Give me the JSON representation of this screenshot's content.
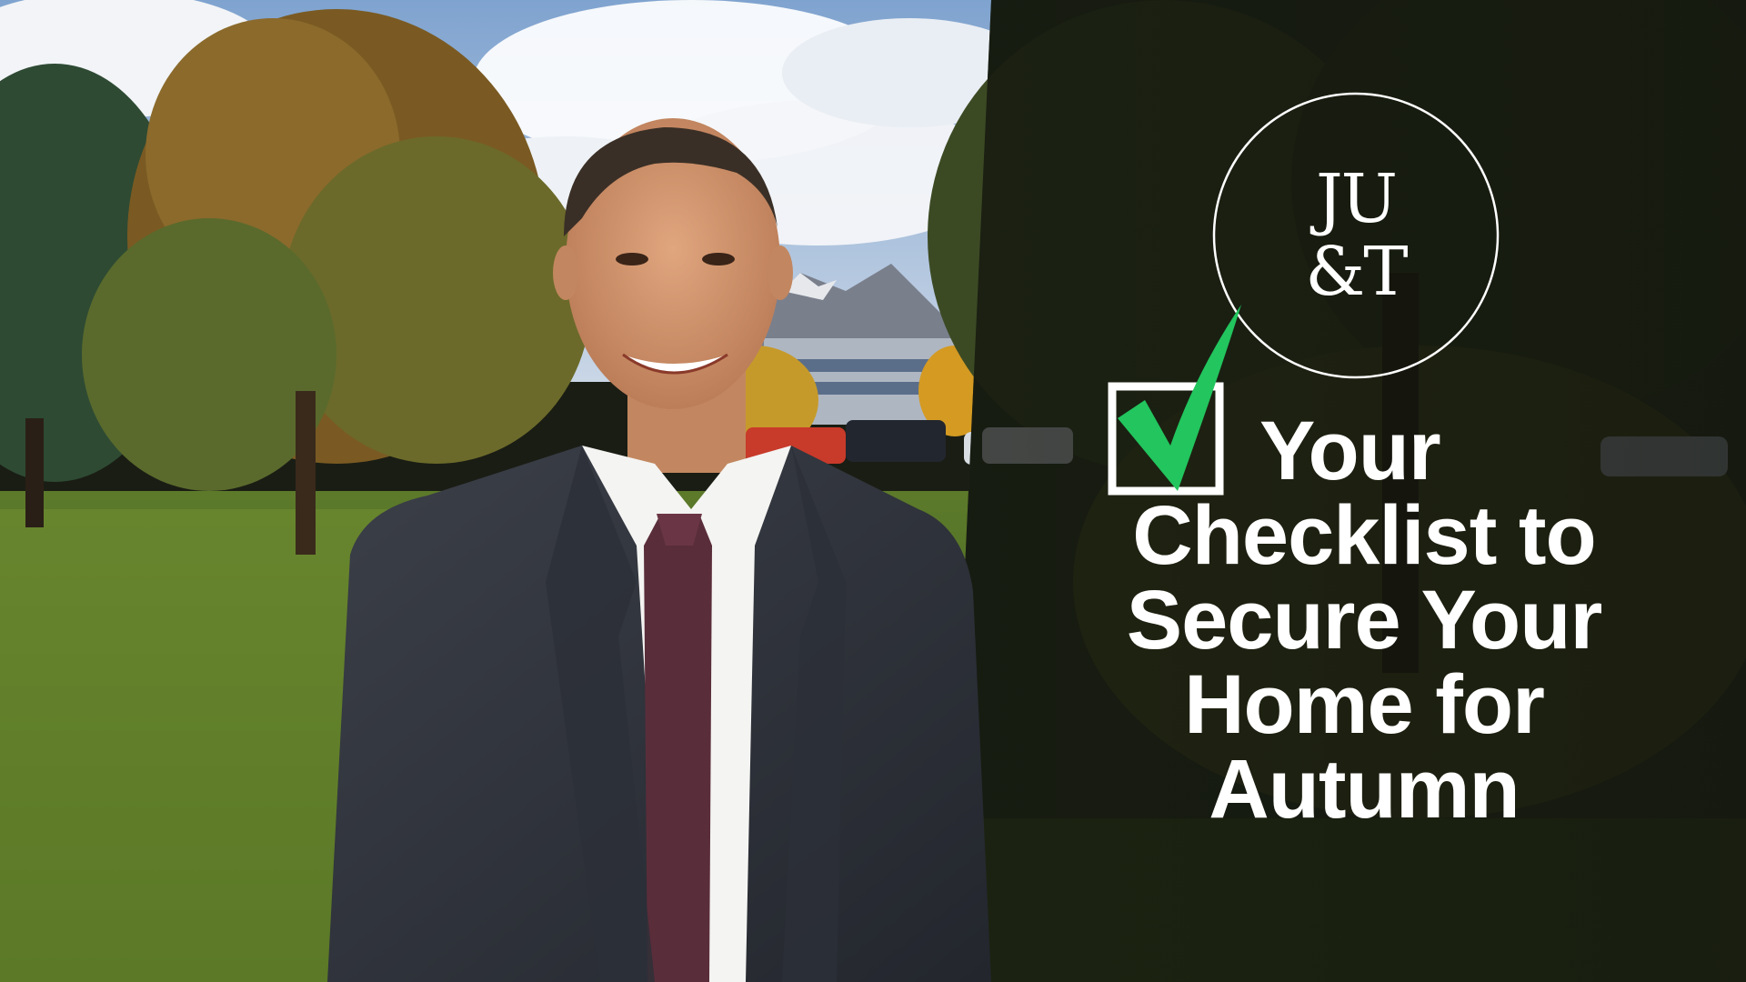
{
  "logo": {
    "line1": "JU",
    "line2": "&T"
  },
  "headline": {
    "line1": "Your",
    "line2": "Checklist to",
    "line3": "Secure Your",
    "line4": "Home for",
    "line5": "Autumn"
  },
  "colors": {
    "check_green": "#22c55e",
    "overlay_dark": "#12140e",
    "text": "#ffffff"
  },
  "icons": {
    "checkbox": "checkbox-icon",
    "checkmark": "checkmark-icon"
  }
}
